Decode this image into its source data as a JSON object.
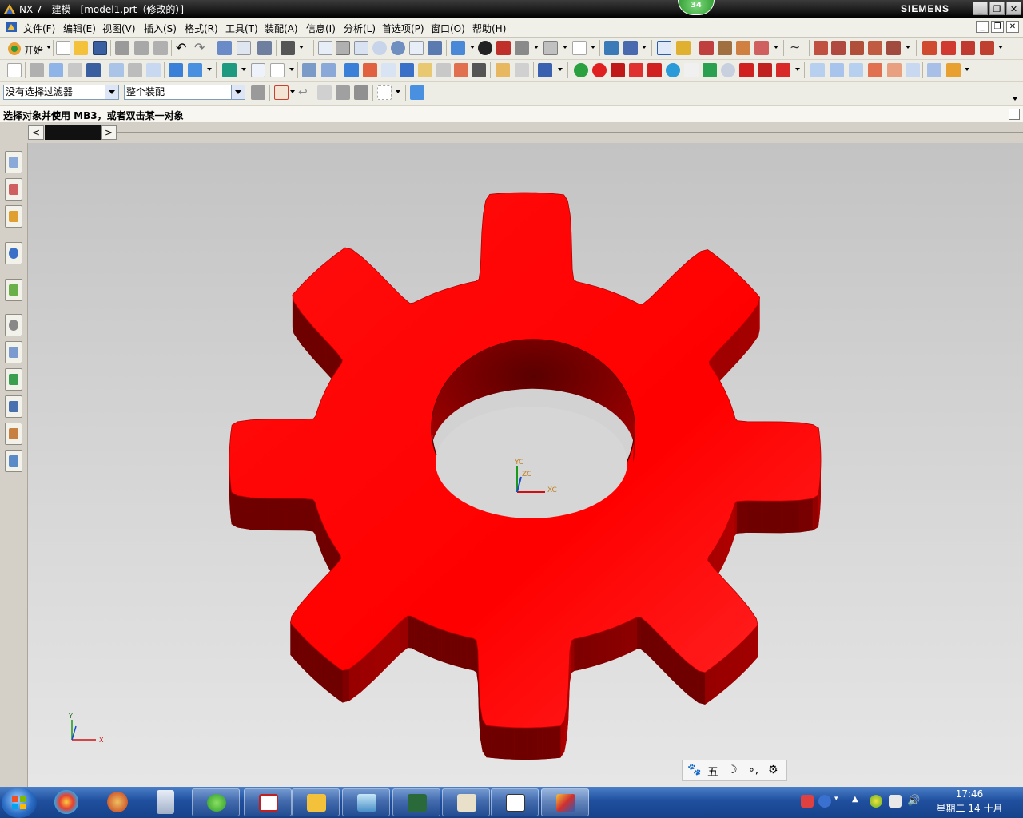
{
  "window": {
    "title": "NX 7 - 建模 - [model1.prt（修改的）]",
    "brand": "SIEMENS",
    "badge": "34",
    "controls": [
      "_",
      "❐",
      "✕"
    ]
  },
  "menu": {
    "items": [
      "文件(F)",
      "编辑(E)",
      "视图(V)",
      "插入(S)",
      "格式(R)",
      "工具(T)",
      "装配(A)",
      "信息(I)",
      "分析(L)",
      "首选项(P)",
      "窗口(O)",
      "帮助(H)"
    ],
    "mdi_controls": [
      "_",
      "❐",
      "✕"
    ]
  },
  "toolbar1": {
    "start_label": "开始"
  },
  "selection_bar": {
    "filter_value": "没有选择过滤器",
    "scope_value": "整个装配"
  },
  "cue_line": "选择对象并使用 MB3，或者双击某一对象",
  "resource_bar": {
    "left_arrow": "<",
    "right_arrow": ">"
  },
  "viewport": {
    "model_color": "#ff0000",
    "wcs_labels": {
      "yc": "YC",
      "zc": "ZC",
      "xc": "XC"
    },
    "triad_labels": {
      "y": "Y",
      "x": "X"
    }
  },
  "ime": {
    "items": [
      "🐾",
      "五",
      "☽",
      "∘,",
      "⚙"
    ]
  },
  "taskbar": {
    "clock_time": "17:46",
    "clock_date": "星期二 14 十月"
  }
}
